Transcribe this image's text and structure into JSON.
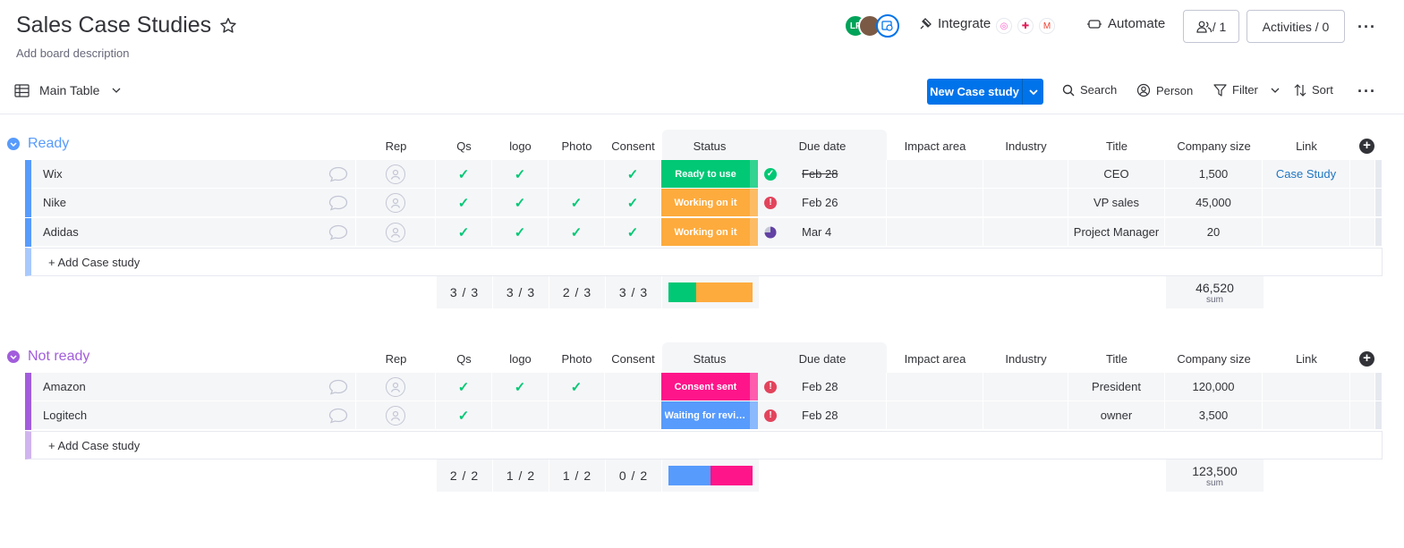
{
  "board": {
    "title": "Sales Case Studies",
    "description": "Add board description"
  },
  "header": {
    "avatars": [
      "LF",
      "",
      ""
    ],
    "integrate_label": "Integrate",
    "automate_label": "Automate",
    "members_label": "/ 1",
    "activities_label": "Activities / 0"
  },
  "toolbar": {
    "view_label": "Main Table",
    "new_item_label": "New Case study",
    "search_label": "Search",
    "person_label": "Person",
    "filter_label": "Filter",
    "sort_label": "Sort"
  },
  "columns": [
    "Rep",
    "Qs",
    "logo",
    "Photo",
    "Consent",
    "Status",
    "Due date",
    "Impact area",
    "Industry",
    "Title",
    "Company size",
    "Link"
  ],
  "colors": {
    "ready_group": "#579bfc",
    "not_ready_group": "#a25ddc",
    "done": "#00c875",
    "working": "#fdab3d",
    "consent_sent": "#ff158a",
    "waiting": "#579bfc",
    "accent": "#0073ea"
  },
  "groups": [
    {
      "name": "Ready",
      "add_label": "+ Add Case study",
      "rows": [
        {
          "name": "Wix",
          "qs": true,
          "logo": true,
          "photo": false,
          "consent": true,
          "status": "Ready to use",
          "due": "Feb 28",
          "due_state": "done",
          "title": "CEO",
          "company_size": "1,500",
          "link": "Case Study"
        },
        {
          "name": "Nike",
          "qs": true,
          "logo": true,
          "photo": true,
          "consent": true,
          "status": "Working on it",
          "due": "Feb 26",
          "due_state": "overdue",
          "title": "VP sales",
          "company_size": "45,000",
          "link": ""
        },
        {
          "name": "Adidas",
          "qs": true,
          "logo": true,
          "photo": true,
          "consent": true,
          "status": "Working on it",
          "due": "Mar 4",
          "due_state": "progress",
          "title": "Project Manager",
          "company_size": "20",
          "link": ""
        }
      ],
      "summary": {
        "qs": "3 / 3",
        "logo": "3 / 3",
        "photo": "2 / 3",
        "consent": "3 / 3",
        "status_split": [
          {
            "status": "Ready to use",
            "fraction": 0.333
          },
          {
            "status": "Working on it",
            "fraction": 0.667
          }
        ],
        "company_size_sum": "46,520",
        "sum_label": "sum"
      }
    },
    {
      "name": "Not ready",
      "add_label": "+ Add Case study",
      "rows": [
        {
          "name": "Amazon",
          "qs": true,
          "logo": true,
          "photo": true,
          "consent": false,
          "status": "Consent sent",
          "due": "Feb 28",
          "due_state": "overdue",
          "title": "President",
          "company_size": "120,000",
          "link": ""
        },
        {
          "name": "Logitech",
          "qs": true,
          "logo": false,
          "photo": false,
          "consent": false,
          "status": "Waiting for review",
          "due": "Feb 28",
          "due_state": "overdue",
          "title": "owner",
          "company_size": "3,500",
          "link": ""
        }
      ],
      "summary": {
        "qs": "2 / 2",
        "logo": "1 / 2",
        "photo": "1 / 2",
        "consent": "0 / 2",
        "status_split": [
          {
            "status": "Waiting for review",
            "fraction": 0.5
          },
          {
            "status": "Consent sent",
            "fraction": 0.5
          }
        ],
        "company_size_sum": "123,500",
        "sum_label": "sum"
      }
    }
  ]
}
